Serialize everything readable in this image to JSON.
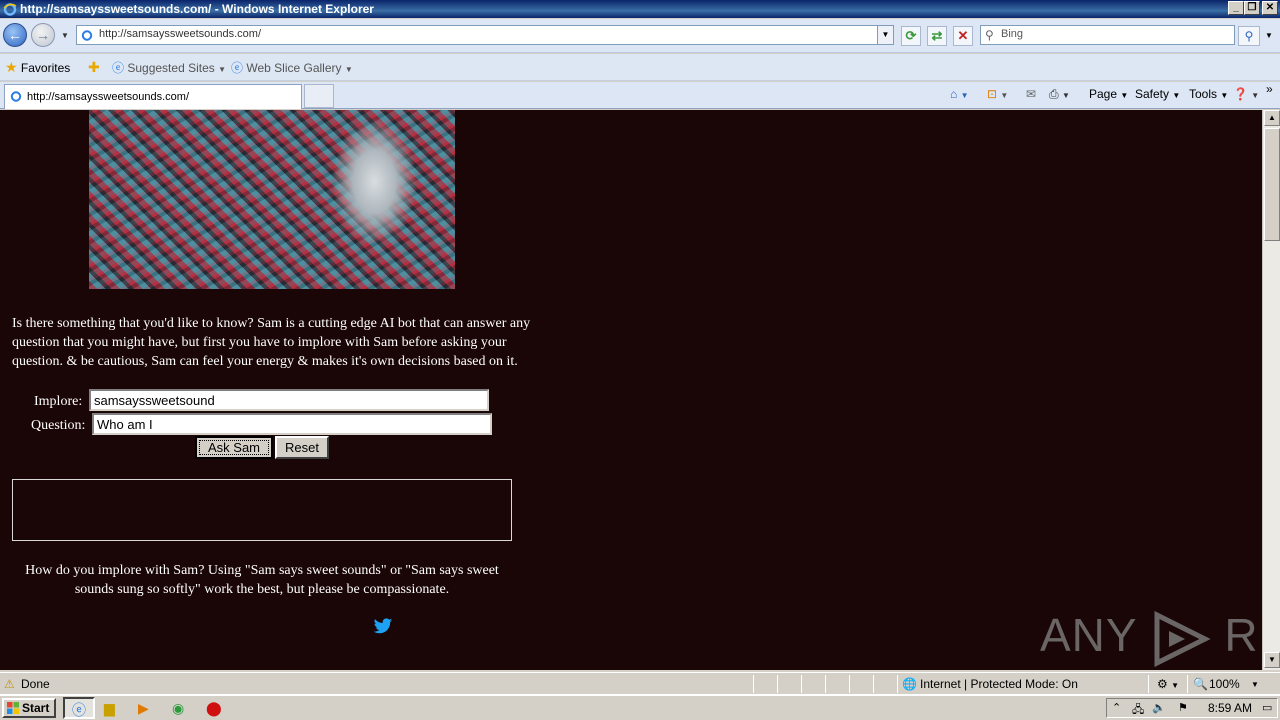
{
  "window": {
    "title": "http://samsayssweetsounds.com/ - Windows Internet Explorer",
    "min_icon": "minimize-icon",
    "restore_icon": "restore-icon",
    "close_icon": "close-icon"
  },
  "addressbar": {
    "url": "http://samsayssweetsounds.com/",
    "search_placeholder": "Bing"
  },
  "favorites": {
    "favorites_label": "Favorites",
    "suggested_sites": "Suggested Sites",
    "web_slice_gallery": "Web Slice Gallery"
  },
  "tabs": [
    {
      "label": "http://samsayssweetsounds.com/"
    }
  ],
  "command_bar": {
    "page": "Page",
    "safety": "Safety",
    "tools": "Tools"
  },
  "page": {
    "intro": "Is there something that you'd like to know? Sam is a cutting edge AI bot that can answer any question that you might have, but first you have to implore with Sam before asking your question. & be cautious, Sam can feel your energy & makes it's own decisions based on it.",
    "implore_label": "Implore:",
    "implore_value": "samsayssweetsound",
    "question_label": "Question:",
    "question_value": "Who am I",
    "ask_button": "Ask Sam",
    "reset_button": "Reset",
    "howto": "How do you implore with Sam? Using \"Sam says sweet sounds\" or \"Sam says sweet sounds sung so softly\" work the best, but please be compassionate.",
    "twitter_color": "#1da1f2",
    "background_color": "#1a0606"
  },
  "watermark": {
    "text_left": "ANY",
    "text_right": "RUN"
  },
  "statusbar": {
    "status": "Done",
    "zone": "Internet | Protected Mode: On",
    "zoom": "100%"
  },
  "taskbar": {
    "start": "Start",
    "clock": "8:59 AM"
  }
}
